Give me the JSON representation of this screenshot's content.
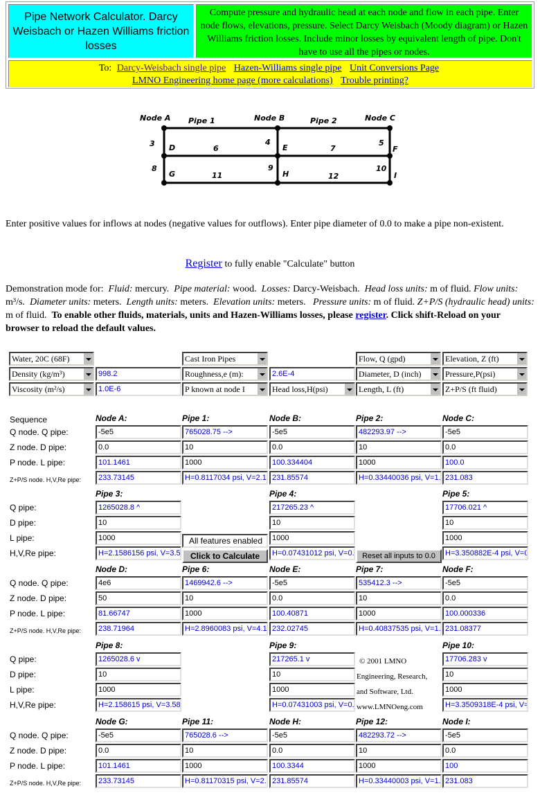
{
  "header": {
    "title": "Pipe Network Calculator. Darcy Weisbach or Hazen Williams friction losses",
    "description": "Compute pressure and hydraulic head at each node and flow in each pipe. Enter node flows, elevations, pressure. Select Darcy Weisbach (Moody diagram) or Hazen Williams friction losses.   Include minor losses by equivalent length of pipe.  Don't have to use all the pipes or nodes.",
    "links_prefix": "To:",
    "links": [
      {
        "label": "Darcy-Weisbach single pipe",
        "visited": true
      },
      {
        "label": "Hazen-Williams single pipe",
        "visited": false
      },
      {
        "label": "Unit Conversions Page",
        "visited": false
      },
      {
        "label": "LMNO Engineering home page (more calculations)",
        "visited": false
      },
      {
        "label": "Trouble printing?",
        "visited": false
      }
    ]
  },
  "diagram": {
    "node_labels": [
      "Node A",
      "Node B",
      "Node C",
      "D",
      "E",
      "F",
      "G",
      "H",
      "I"
    ],
    "pipe_labels": [
      "Pipe 1",
      "Pipe 2",
      "3",
      "4",
      "5",
      "6",
      "7",
      "8",
      "9",
      "10",
      "11",
      "12"
    ]
  },
  "intro": "Enter positive values for inflows at nodes (negative values for outflows).  Enter pipe diameter of 0.0 to make a pipe non-existent.",
  "register_line": {
    "link": "Register",
    "text": " to fully enable \"Calculate\" button"
  },
  "demo": {
    "prefix": "Demonstration mode for:",
    "fluid_label": "Fluid:",
    "fluid": "mercury.",
    "material_label": "Pipe material:",
    "material": "wood.",
    "losses_label": "Losses:",
    "losses": "Darcy-Weisbach.",
    "headloss_label": "Head loss units:",
    "headloss": "m of fluid.",
    "flow_label": "Flow units:",
    "flow": "m³/s.",
    "diameter_label": "Diameter units:",
    "diameter": "meters.",
    "length_label": "Length units:",
    "length": "meters.",
    "elevation_label": "Elevation units:",
    "elevation": "meters.",
    "pressure_label": "Pressure units:",
    "pressure": "m of fluid.",
    "zps_label": "Z+P/S (hydraulic head) units:",
    "zps": "m of fluid.",
    "bold_text": "To enable other fluids, materials, units and Hazen-Williams losses, please",
    "register_link": "register",
    "bold_tail": ".  Click shift-Reload on your browser to reload the default values."
  },
  "settings": {
    "fluid_select": "Water, 20C (68F)",
    "density_select": "Density (kg/m³)",
    "density_value": "998.2",
    "viscosity_select": "Viscosity (m²/s)",
    "viscosity_value": "1.0E-6",
    "material_select": "Cast Iron Pipes",
    "roughness_select": "Roughness,e (m):",
    "roughness_value": "2.6E-4",
    "pknown_select": "P known at node I",
    "headloss_select": "Head loss,H(psi)",
    "flow_select": "Flow, Q (gpd)",
    "diameter_select": "Diameter, D (inch)",
    "length_select": "Length, L (ft)",
    "elevation_select": "Elevation, Z (ft)",
    "pressure_select": "Pressure,P(psi)",
    "zps_select": "Z+P/S (ft fluid)"
  },
  "grid": {
    "sequence_label": "Sequence",
    "node_row_labels": [
      "Q node. Q pipe:",
      "Z node. D pipe:",
      "P node. L pipe:",
      "Z+P/S node. H,V,Re pipe:"
    ],
    "pipe_row_labels": [
      "Q pipe:",
      "D pipe:",
      "L pipe:",
      "H,V,Re pipe:"
    ],
    "node_rows": [
      {
        "cols": [
          {
            "head": "Node A:",
            "vals": [
              "-5e5",
              "0.0",
              "101.1461",
              "233.73145"
            ]
          },
          {
            "head": "Pipe 1:",
            "vals": [
              "765028.75  -->",
              "10",
              "1000",
              "H=0.8117034 psi, V=2.1"
            ]
          },
          {
            "head": "Node B:",
            "vals": [
              "-5e5",
              "0.0",
              "100.334404",
              "231.85574"
            ]
          },
          {
            "head": "Pipe 2:",
            "vals": [
              "482293.97  -->",
              "10",
              "1000",
              "H=0.33440036 psi, V=1."
            ]
          },
          {
            "head": "Node C:",
            "vals": [
              "-5e5",
              "0.0",
              "100.0",
              "231.083"
            ]
          }
        ]
      },
      {
        "cols": [
          {
            "head": "Node D:",
            "vals": [
              "4e6",
              "50",
              "81.66747",
              "238.71964"
            ]
          },
          {
            "head": "Pipe 6:",
            "vals": [
              "1469942.6  -->",
              "10",
              "1000",
              "H=2.8960083 psi, V=4.1"
            ]
          },
          {
            "head": "Node E:",
            "vals": [
              "-5e5",
              "0.0",
              "100.40871",
              "232.02745"
            ]
          },
          {
            "head": "Pipe 7:",
            "vals": [
              "535412.3  -->",
              "10",
              "1000",
              "H=0.40837535 psi, V=1."
            ]
          },
          {
            "head": "Node F:",
            "vals": [
              "-5e5",
              "0.0",
              "100.000336",
              "231.08377"
            ]
          }
        ]
      },
      {
        "cols": [
          {
            "head": "Node G:",
            "vals": [
              "-5e5",
              "0.0",
              "101.1461",
              "233.73145"
            ]
          },
          {
            "head": "Pipe 11:",
            "vals": [
              "765028.6  -->",
              "10",
              "1000",
              "H=0.81170315 psi, V=2."
            ]
          },
          {
            "head": "Node H:",
            "vals": [
              "-5e5",
              "0.0",
              "100.3344",
              "231.85574"
            ]
          },
          {
            "head": "Pipe 12:",
            "vals": [
              "482293.72  -->",
              "10",
              "1000",
              "H=0.33440003 psi, V=1."
            ]
          },
          {
            "head": "Node I:",
            "vals": [
              "-5e5",
              "0.0",
              "100",
              "231.083"
            ]
          }
        ]
      }
    ],
    "pipe_rows": [
      {
        "cols": [
          {
            "head": "Pipe 3:",
            "vals": [
              "1265028.8  ^",
              "10",
              "1000",
              "H=2.1586156 psi, V=3.5"
            ]
          },
          {
            "head": "Pipe 4:",
            "vals": [
              "217265.23  ^",
              "10",
              "1000",
              "H=0.07431012 psi, V=0."
            ]
          },
          {
            "head": "Pipe 5:",
            "vals": [
              "17706.021  ^",
              "10",
              "1000",
              "H=3.350882E-4 psi, V=0"
            ]
          }
        ]
      },
      {
        "cols": [
          {
            "head": "Pipe 8:",
            "vals": [
              "1265028.6  v",
              "10",
              "1000",
              "H=2.158615 psi, V=3.58"
            ]
          },
          {
            "head": "Pipe 9:",
            "vals": [
              "217265.1  v",
              "10",
              "1000",
              "H=0.07431003 psi, V=0."
            ]
          },
          {
            "head": "Pipe 10:",
            "vals": [
              "17706.283  v",
              "10",
              "1000",
              "H=3.3509318E-4 psi, V="
            ]
          }
        ]
      }
    ],
    "features_text": "All features enabled",
    "calculate_button": "Click to Calculate",
    "reset_button": "Reset all inputs to 0.0",
    "copyright": [
      "© 2001 LMNO",
      "Engineering, Research,",
      "and Software, Ltd.",
      "www.LMNOeng.com"
    ]
  }
}
